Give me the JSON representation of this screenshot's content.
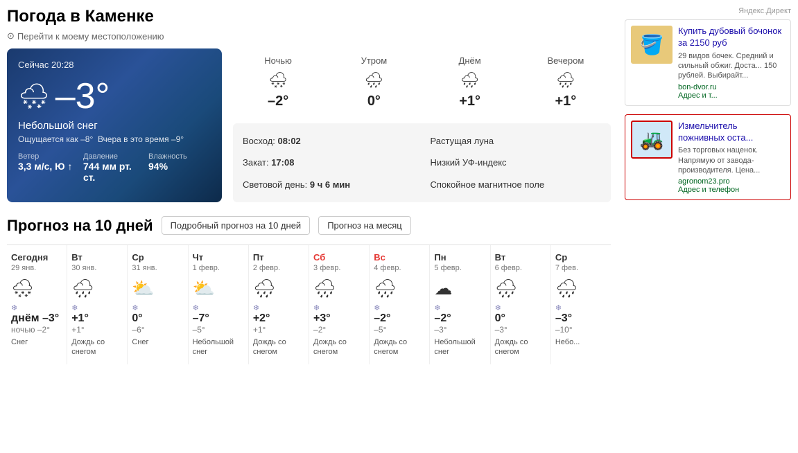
{
  "page": {
    "title": "Погода в Каменке",
    "location_link": "Перейти к моему местоположению"
  },
  "current": {
    "time": "Сейчас 20:28",
    "temp": "–3°",
    "desc": "Небольшой снег",
    "feels_like": "Ощущается как –8°",
    "yesterday": "Вчера в это время –9°",
    "wind_label": "Ветер",
    "wind_value": "3,3 м/с, Ю ↑",
    "pressure_label": "Давление",
    "pressure_value": "744 мм рт. ст.",
    "humidity_label": "Влажность",
    "humidity_value": "94%"
  },
  "timeofday": [
    {
      "label": "Ночью",
      "icon": "🌨",
      "temp": "–2°"
    },
    {
      "label": "Утром",
      "icon": "🌧",
      "temp": "0°"
    },
    {
      "label": "Днём",
      "icon": "🌧",
      "temp": "+1°"
    },
    {
      "label": "Вечером",
      "icon": "🌧",
      "temp": "+1°"
    }
  ],
  "sun_info": {
    "sunrise_label": "Восход:",
    "sunrise": "08:02",
    "sunset_label": "Закат:",
    "sunset": "17:08",
    "daylight_label": "Световой день:",
    "daylight": "9 ч 6 мин",
    "moon_label": "Растущая луна",
    "uv_label": "Низкий УФ-индекс",
    "magnetic_label": "Спокойное магнитное поле"
  },
  "forecast_section": {
    "title": "Прогноз на 10 дней",
    "btn1": "Подробный прогноз на 10 дней",
    "btn2": "Прогноз на месяц"
  },
  "forecast_days": [
    {
      "name": "Сегодня",
      "weekend": false,
      "date": "29 янв.",
      "icon": "🌨",
      "extra": "❄",
      "high": "днём –3°",
      "low": "ночью –2°",
      "desc": "Снег"
    },
    {
      "name": "Вт",
      "weekend": false,
      "date": "30 янв.",
      "icon": "🌧",
      "extra": "❄",
      "high": "+1°",
      "low": "+1°",
      "desc": "Дождь со снегом"
    },
    {
      "name": "Ср",
      "weekend": false,
      "date": "31 янв.",
      "icon": "⛅",
      "extra": "❄",
      "high": "0°",
      "low": "–6°",
      "desc": "Снег"
    },
    {
      "name": "Чт",
      "weekend": false,
      "date": "1 февр.",
      "icon": "⛅",
      "extra": "❄",
      "high": "–7°",
      "low": "–5°",
      "desc": "Небольшой снег"
    },
    {
      "name": "Пт",
      "weekend": false,
      "date": "2 февр.",
      "icon": "🌧",
      "extra": "❄",
      "high": "+2°",
      "low": "+1°",
      "desc": "Дождь со снегом"
    },
    {
      "name": "Сб",
      "weekend": true,
      "date": "3 февр.",
      "icon": "🌧",
      "extra": "❄",
      "high": "+3°",
      "low": "–2°",
      "desc": "Дождь со снегом"
    },
    {
      "name": "Вс",
      "weekend": true,
      "date": "4 февр.",
      "icon": "🌧",
      "extra": "❄",
      "high": "–2°",
      "low": "–5°",
      "desc": "Дождь со снегом"
    },
    {
      "name": "Пн",
      "weekend": false,
      "date": "5 февр.",
      "icon": "☁",
      "extra": "❄",
      "high": "–2°",
      "low": "–3°",
      "desc": "Небольшой снег"
    },
    {
      "name": "Вт",
      "weekend": false,
      "date": "6 февр.",
      "icon": "🌧",
      "extra": "❄",
      "high": "0°",
      "low": "–3°",
      "desc": "Дождь со снегом"
    },
    {
      "name": "Ср",
      "weekend": false,
      "date": "7 фев.",
      "icon": "🌧",
      "extra": "❄",
      "high": "–3°",
      "low": "–10°",
      "desc": "Небо..."
    }
  ],
  "ads": {
    "label": "Яндекс.Директ",
    "ad1": {
      "title": "Купить дубовый бочонок за 2150 руб",
      "desc": "29 видов бочек. Средний и сильный обжиг. Доста... 150 рублей. Выбирайт...",
      "link": "bon-dvor.ru",
      "link2": "Адрес и т..."
    },
    "ad2": {
      "title": "Измельчитель пожнивных оста...",
      "desc": "Без торговых наценок. Напрямую от завода-производителя. Цена...",
      "link": "agronom23.pro",
      "link2": "Адрес и телефон"
    }
  }
}
